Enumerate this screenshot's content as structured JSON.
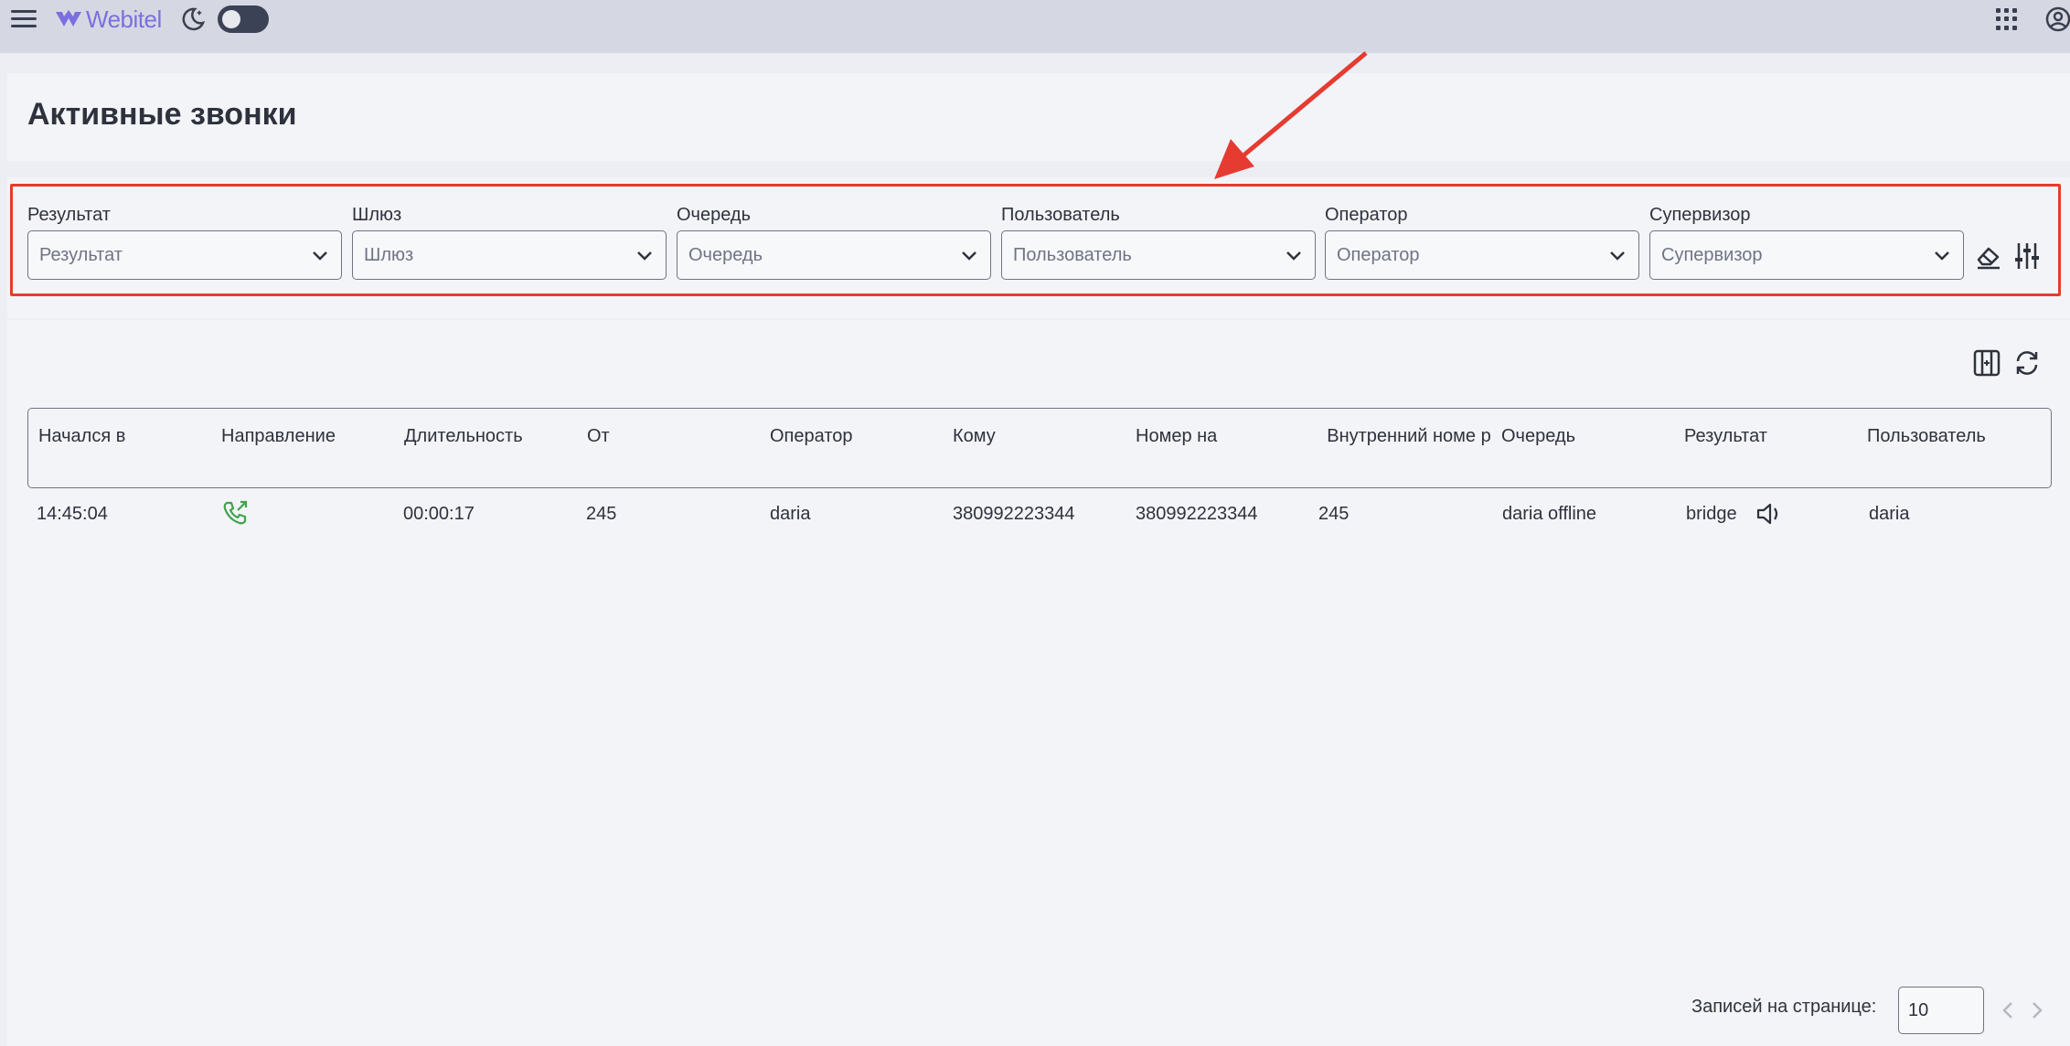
{
  "app": {
    "brand": "Webitel"
  },
  "page": {
    "title": "Активные звонки"
  },
  "filters": [
    {
      "label": "Результат",
      "placeholder": "Результат"
    },
    {
      "label": "Шлюз",
      "placeholder": "Шлюз"
    },
    {
      "label": "Очередь",
      "placeholder": "Очередь"
    },
    {
      "label": "Пользователь",
      "placeholder": "Пользователь"
    },
    {
      "label": "Оператор",
      "placeholder": "Оператор"
    },
    {
      "label": "Супервизор",
      "placeholder": "Супервизор"
    }
  ],
  "table": {
    "columns": [
      "Начался в",
      "Направление",
      "Длительность",
      "От",
      "Оператор",
      "Кому",
      "Номер на",
      "Внутренний номе р",
      "Очередь",
      "Результат",
      "Пользователь"
    ],
    "rows": [
      {
        "started": "14:45:04",
        "direction_icon": "phone-outbound-icon",
        "duration": "00:00:17",
        "from": "245",
        "operator": "daria",
        "to": "380992223344",
        "number_on": "380992223344",
        "extension": "245",
        "queue": "daria offline",
        "result": "bridge",
        "user": "daria"
      }
    ]
  },
  "pagination": {
    "label": "Записей на странице:",
    "page_size": "10"
  },
  "colors": {
    "accent": "#7c6fe0",
    "highlight": "#e53b31",
    "direction_green": "#3fa34d"
  },
  "icons": [
    "menu-icon",
    "webitel-logo-icon",
    "moon-icon",
    "apps-grid-icon",
    "account-icon",
    "eraser-icon",
    "sliders-icon",
    "columns-icon",
    "refresh-icon",
    "speaker-icon",
    "chevron-down-icon",
    "chevron-left-icon",
    "chevron-right-icon"
  ]
}
